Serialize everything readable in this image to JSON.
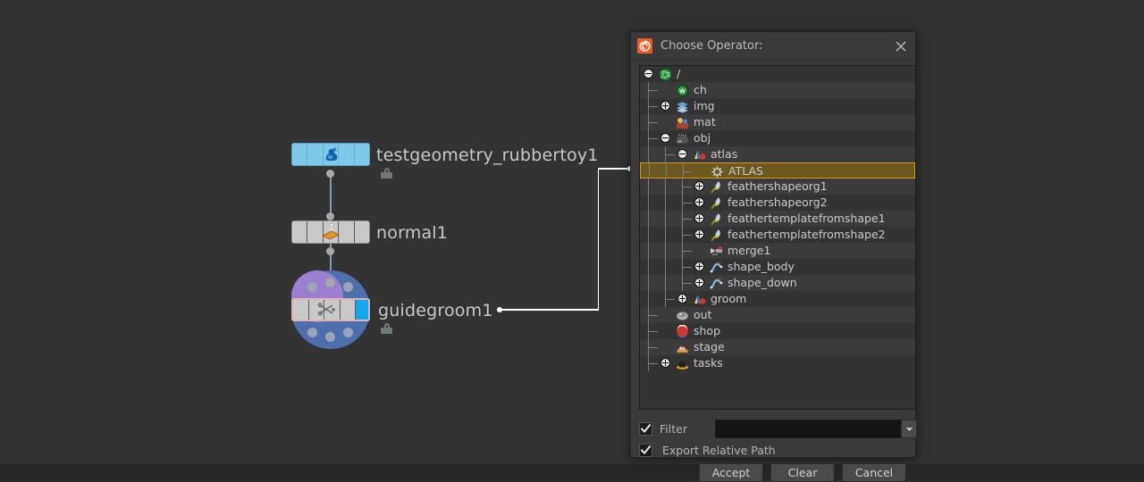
{
  "network": {
    "nodes": [
      {
        "name": "testgeometry_rubbertoy1",
        "icon": "rubbertoy-icon",
        "color": "#7ec9ea",
        "locked": true,
        "selected": false
      },
      {
        "name": "normal1",
        "icon": "normal-icon",
        "color": "#c9c9c9",
        "locked": false,
        "selected": false
      },
      {
        "name": "guidegroom1",
        "icon": "guidegroom-icon",
        "color": "#c9c9c9",
        "locked": true,
        "selected": true
      }
    ]
  },
  "dialog": {
    "title": "Choose Operator:",
    "logo_icon": "houdini-logo-icon",
    "close_icon": "close-icon",
    "tree": [
      {
        "label": "/",
        "depth": 0,
        "icon": "globe-icon",
        "expander": "minus",
        "selected": false
      },
      {
        "label": "ch",
        "depth": 1,
        "icon": "channels-icon",
        "expander": "none",
        "selected": false
      },
      {
        "label": "img",
        "depth": 1,
        "icon": "compositing-icon",
        "expander": "plus",
        "selected": false
      },
      {
        "label": "mat",
        "depth": 1,
        "icon": "material-icon",
        "expander": "none",
        "selected": false
      },
      {
        "label": "obj",
        "depth": 1,
        "icon": "object-icon",
        "expander": "minus",
        "selected": false
      },
      {
        "label": "atlas",
        "depth": 2,
        "icon": "geometry-icon",
        "expander": "minus",
        "selected": false
      },
      {
        "label": "ATLAS",
        "depth": 3,
        "icon": "gear-icon",
        "expander": "none",
        "selected": true
      },
      {
        "label": "feathershapeorg1",
        "depth": 3,
        "icon": "feather-icon",
        "expander": "plus",
        "selected": false
      },
      {
        "label": "feathershapeorg2",
        "depth": 3,
        "icon": "feather-icon",
        "expander": "plus",
        "selected": false
      },
      {
        "label": "feathertemplatefromshape1",
        "depth": 3,
        "icon": "feather-icon",
        "expander": "plus",
        "selected": false
      },
      {
        "label": "feathertemplatefromshape2",
        "depth": 3,
        "icon": "feather-icon",
        "expander": "plus",
        "selected": false
      },
      {
        "label": "merge1",
        "depth": 3,
        "icon": "merge-icon",
        "expander": "none",
        "selected": false
      },
      {
        "label": "shape_body",
        "depth": 3,
        "icon": "curve-icon",
        "expander": "plus",
        "selected": false
      },
      {
        "label": "shape_down",
        "depth": 3,
        "icon": "curve-icon",
        "expander": "plus",
        "selected": false
      },
      {
        "label": "groom",
        "depth": 2,
        "icon": "geometry-icon",
        "expander": "plus",
        "selected": false
      },
      {
        "label": "out",
        "depth": 1,
        "icon": "render-icon",
        "expander": "none",
        "selected": false
      },
      {
        "label": "shop",
        "depth": 1,
        "icon": "shop-icon",
        "expander": "none",
        "selected": false
      },
      {
        "label": "stage",
        "depth": 1,
        "icon": "stage-icon",
        "expander": "none",
        "selected": false
      },
      {
        "label": "tasks",
        "depth": 1,
        "icon": "tasks-icon",
        "expander": "plus",
        "selected": false
      }
    ],
    "filter": {
      "label": "Filter",
      "checked": true,
      "value": "",
      "placeholder": "",
      "dropdown_icon": "chevron-down-icon"
    },
    "export_relative_path": {
      "label": "Export Relative Path",
      "checked": true
    },
    "buttons": [
      {
        "label": "Accept",
        "name": "accept-button"
      },
      {
        "label": "Clear",
        "name": "clear-button"
      },
      {
        "label": "Cancel",
        "name": "cancel-button"
      }
    ]
  },
  "colors": {
    "selected_row_bg": "#6a5a20",
    "selected_row_border": "#d9951d",
    "accent_orange": "#f05a28",
    "node_selected_border": "#e0b4b0",
    "link": "#ffffff"
  }
}
